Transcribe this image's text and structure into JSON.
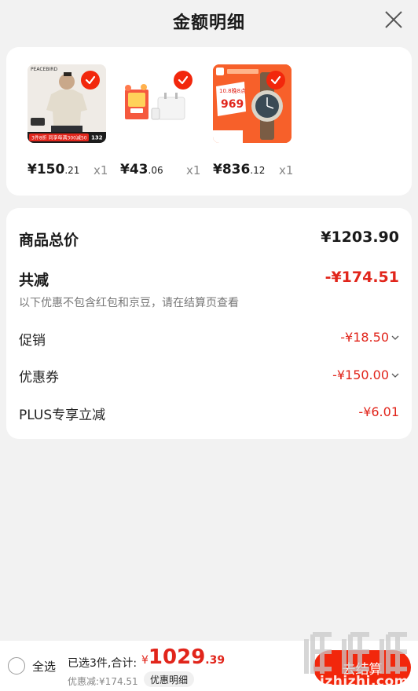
{
  "header": {
    "title": "金额明细"
  },
  "products": [
    {
      "name": "PEACEBIRD men tee",
      "price_int": "¥150",
      "price_dec": ".21",
      "qty": "x1",
      "thumb_logo": "PEACEBIRD",
      "thumb_banner": "3件8折 同享每满300减50",
      "thumb_price": "132"
    },
    {
      "name": "charger",
      "price_int": "¥43",
      "price_dec": ".06",
      "qty": "x1"
    },
    {
      "name": "Xiaomi watch",
      "price_int": "¥836",
      "price_dec": ".12",
      "qty": "x1",
      "thumb_price": "969",
      "thumb_tag": "10.8晚8点"
    }
  ],
  "summary": {
    "total_label": "商品总价",
    "total_value": "¥1203.90",
    "reduce_label": "共减",
    "reduce_value": "-¥174.51",
    "reduce_note": "以下优惠不包含红包和京豆，请在结算页查看",
    "items": [
      {
        "label": "促销",
        "value": "-¥18.50",
        "expandable": true
      },
      {
        "label": "优惠券",
        "value": "-¥150.00",
        "expandable": true
      },
      {
        "label": "PLUS专享立减",
        "value": "-¥6.01",
        "expandable": false
      }
    ]
  },
  "bottom": {
    "select_all": "全选",
    "selected": "已选3件,合计:",
    "currency": "¥",
    "sum_int": "1029",
    "sum_dec": ".39",
    "discount": "优惠减:¥174.51",
    "detail_chip": "优惠明细",
    "checkout": "去结算"
  },
  "watermark": {
    "text": "zhizhizhi.com"
  },
  "colors": {
    "accent": "#f2270c",
    "price_red": "#e1251b"
  }
}
